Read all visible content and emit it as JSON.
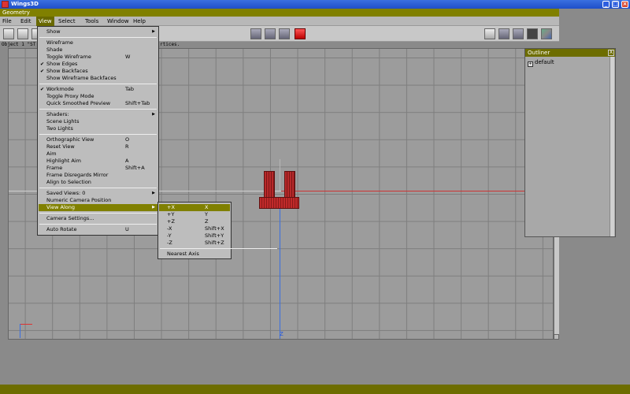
{
  "app_title": "Wings3D",
  "window_title": "Geometry",
  "menus": [
    "File",
    "Edit",
    "View",
    "Select",
    "Tools",
    "Window",
    "Help"
  ],
  "info_line": "Object 1 \"ST",
  "info_tail": "rtices.",
  "view_menu": {
    "items": [
      {
        "label": "Show",
        "shortcut": "",
        "submenu": true,
        "check": false
      },
      {
        "label": "Wireframe",
        "shortcut": "",
        "submenu": false,
        "check": false
      },
      {
        "label": "Shade",
        "shortcut": "",
        "submenu": false,
        "check": false
      },
      {
        "label": "Toggle Wireframe",
        "shortcut": "W",
        "submenu": false,
        "check": false
      },
      {
        "label": "Show Edges",
        "shortcut": "",
        "submenu": false,
        "check": true
      },
      {
        "label": "Show Backfaces",
        "shortcut": "",
        "submenu": false,
        "check": true
      },
      {
        "label": "Show Wireframe Backfaces",
        "shortcut": "",
        "submenu": false,
        "check": false
      },
      {
        "label": "Workmode",
        "shortcut": "Tab",
        "submenu": false,
        "check": true
      },
      {
        "label": "Toggle Proxy Mode",
        "shortcut": "",
        "submenu": false,
        "check": false
      },
      {
        "label": "Quick Smoothed Preview",
        "shortcut": "Shift+Tab",
        "submenu": false,
        "check": false
      },
      {
        "label": "Shaders:",
        "shortcut": "",
        "submenu": true,
        "check": false
      },
      {
        "label": "Scene Lights",
        "shortcut": "",
        "submenu": false,
        "check": false
      },
      {
        "label": "Two Lights",
        "shortcut": "",
        "submenu": false,
        "check": false
      },
      {
        "label": "Orthographic View",
        "shortcut": "O",
        "submenu": false,
        "check": false
      },
      {
        "label": "Reset View",
        "shortcut": "R",
        "submenu": false,
        "check": false
      },
      {
        "label": "Aim",
        "shortcut": "",
        "submenu": false,
        "check": false
      },
      {
        "label": "Highlight Aim",
        "shortcut": "A",
        "submenu": false,
        "check": false
      },
      {
        "label": "Frame",
        "shortcut": "Shift+A",
        "submenu": false,
        "check": false
      },
      {
        "label": "Frame Disregards Mirror",
        "shortcut": "",
        "submenu": false,
        "check": false
      },
      {
        "label": "Align to Selection",
        "shortcut": "",
        "submenu": false,
        "check": false
      },
      {
        "label": "Saved Views: 0",
        "shortcut": "",
        "submenu": true,
        "check": false
      },
      {
        "label": "Numeric Camera Position",
        "shortcut": "",
        "submenu": false,
        "check": false
      },
      {
        "label": "View Along",
        "shortcut": "",
        "submenu": true,
        "check": false,
        "highlighted": true
      },
      {
        "label": "Camera Settings...",
        "shortcut": "",
        "submenu": false,
        "check": false
      },
      {
        "label": "Auto Rotate",
        "shortcut": "U",
        "submenu": false,
        "check": false
      }
    ]
  },
  "view_along_submenu": {
    "items": [
      {
        "label": "+X",
        "shortcut": "X",
        "highlighted": true
      },
      {
        "label": "+Y",
        "shortcut": "Y"
      },
      {
        "label": "+Z",
        "shortcut": "Z"
      },
      {
        "label": "-X",
        "shortcut": "Shift+X"
      },
      {
        "label": "-Y",
        "shortcut": "Shift+Y"
      },
      {
        "label": "-Z",
        "shortcut": "Shift+Z"
      },
      {
        "label": "Nearest Axis",
        "shortcut": ""
      }
    ]
  },
  "outliner": {
    "title": "Outliner",
    "close": "X",
    "item_label": "default",
    "item_icon_glyph": "+"
  },
  "viewport": {
    "axis_label": "Z"
  },
  "colors": {
    "accent": "#808000",
    "title_bar": "#1f4fc8",
    "model": "#c02a2a"
  }
}
